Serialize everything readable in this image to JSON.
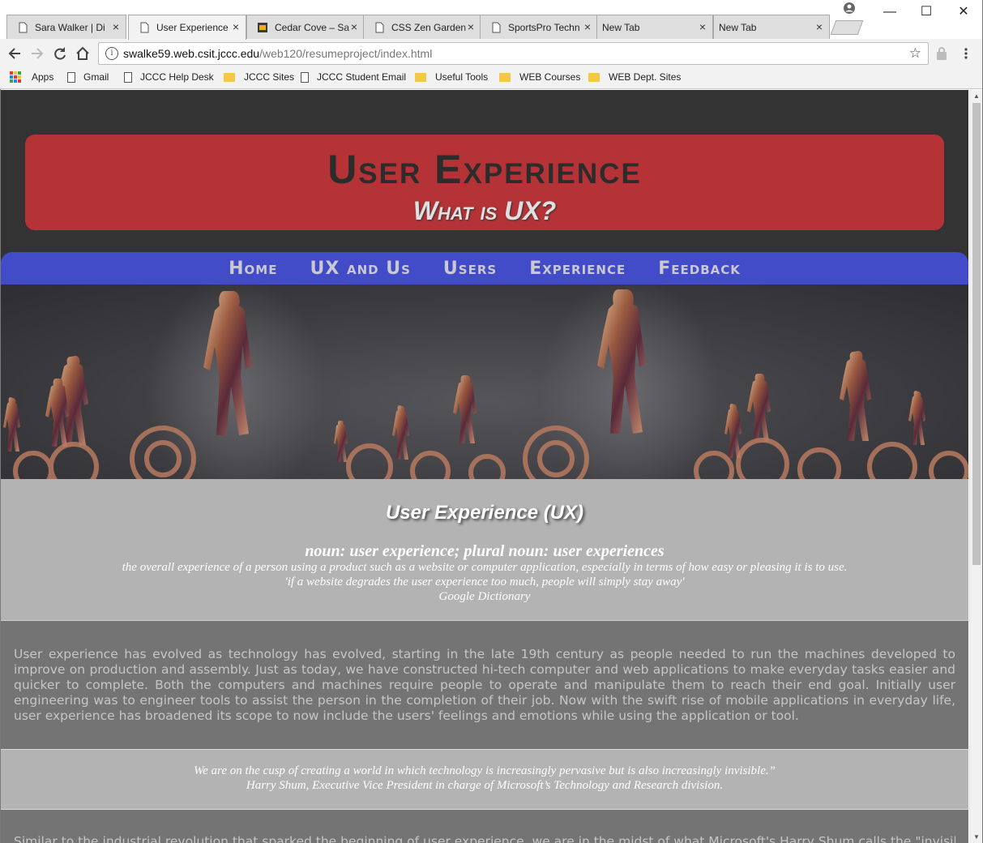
{
  "browser": {
    "tabs": [
      {
        "title": "Sara Walker | Di",
        "favicon": "page-icon"
      },
      {
        "title": "User Experience",
        "favicon": "page-icon",
        "active": true
      },
      {
        "title": "Cedar Cove – Sa",
        "favicon": "cedar-cove-icon"
      },
      {
        "title": "CSS Zen Garden",
        "favicon": "page-icon"
      },
      {
        "title": "SportsPro Techn",
        "favicon": "page-icon"
      },
      {
        "title": "New Tab",
        "favicon": ""
      },
      {
        "title": "New Tab",
        "favicon": ""
      }
    ],
    "tab_close": "×",
    "window_controls": {
      "minimize": "—",
      "maximize": "☐",
      "close": "✕"
    },
    "address": {
      "host": "swalke59.web.csit.jccc.edu",
      "path": "/web120/resumeproject/index.html"
    },
    "bookmarks": [
      {
        "label": "Apps",
        "type": "apps"
      },
      {
        "label": "Gmail",
        "type": "page"
      },
      {
        "label": "JCCC Help Desk",
        "type": "page"
      },
      {
        "label": "JCCC Sites",
        "type": "folder"
      },
      {
        "label": "JCCC Student Email",
        "type": "page"
      },
      {
        "label": "Useful Tools",
        "type": "folder"
      },
      {
        "label": "WEB Courses",
        "type": "folder"
      },
      {
        "label": "WEB Dept. Sites",
        "type": "folder"
      }
    ]
  },
  "site": {
    "title": "User Experience",
    "subtitle": "What is UX?",
    "nav": [
      "Home",
      "UX and Us",
      "Users",
      "Experience",
      "Feedback"
    ],
    "definition": {
      "heading": "User Experience (UX)",
      "noun": "noun: user experience; plural noun: user experiences",
      "meaning": "the overall experience of a person using a product such as a website or computer application, especially in terms of how easy or pleasing it is to use.",
      "example": "'if a website degrades the user experience too much, people will simply stay away'",
      "source": "Google Dictionary"
    },
    "paragraph1": "User experience has evolved as technology has evolved, starting in the late 19th century as people needed to run the machines developed to improve on production and assembly. Just as today, we have constructed hi-tech computer and web applications to make everyday tasks easier and quicker to complete. Both the computers and machines require people to operate and manipulate them to reach their end goal. Initially user engineering was to engineer tools to assist the person in the completion of their job. Now with the swift rise of mobile applications in everyday life, user experience has broadened its scope to now include the users' feelings and emotions while using the application or tool.",
    "quote": {
      "text": "We are on the cusp of creating a world in which technology is increasingly pervasive but is also increasingly invisible.”",
      "attribution": "Harry Shum, Executive Vice President in charge of Microsoft’s Technology and Research division."
    },
    "paragraph2": "Similar to the industrial revolution that sparked the beginning of user experience, we are in the midst of what Microsoft's Harry Shum calls the \"invisible"
  }
}
